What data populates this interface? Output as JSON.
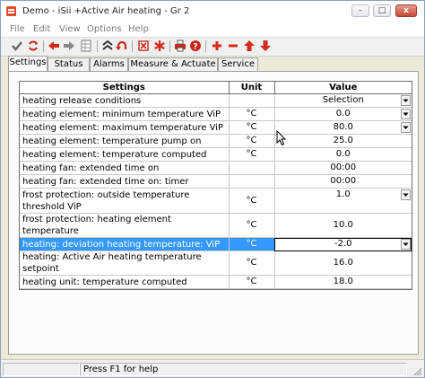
{
  "window": {
    "title": "Demo - iSii +Active Air heating - Gr 2",
    "controls": {
      "minimize": "–",
      "maximize": "□",
      "close": "x"
    }
  },
  "menu": [
    "File",
    "Edit",
    "View",
    "Options",
    "Help"
  ],
  "toolbar": {
    "icons": [
      "check-icon",
      "refresh-icon",
      "back-arrow-icon",
      "forward-arrow-icon",
      "grid-icon",
      "collapse-icon",
      "undo-icon",
      "cancel-box-icon",
      "asterisk-icon",
      "print-icon",
      "help-icon",
      "add-icon",
      "remove-icon",
      "move-up-icon",
      "move-down-icon"
    ]
  },
  "tabs": [
    {
      "label": "Settings",
      "active": true
    },
    {
      "label": "Status",
      "active": false
    },
    {
      "label": "Alarms",
      "active": false
    },
    {
      "label": "Measure & Actuate",
      "active": false
    },
    {
      "label": "Service",
      "active": false
    }
  ],
  "grid": {
    "headers": {
      "setting": "Settings",
      "unit": "Unit",
      "value": "Value"
    },
    "rows": [
      {
        "setting": "heating release conditions",
        "unit": "",
        "value": "Selection",
        "dropdown": true
      },
      {
        "setting": "heating element: minimum temperature ViP",
        "unit": "°C",
        "value": "0.0",
        "dropdown": true
      },
      {
        "setting": "heating element: maximum temperature ViP",
        "unit": "°C",
        "value": "80.0",
        "dropdown": true
      },
      {
        "setting": "heating element: temperature pump on",
        "unit": "°C",
        "value": "25.0",
        "dropdown": false
      },
      {
        "setting": "heating element: temperature computed",
        "unit": "°C",
        "value": "0.0",
        "dropdown": false
      },
      {
        "setting": "heating fan: extended time on",
        "unit": "",
        "value": "00:00",
        "dropdown": false
      },
      {
        "setting": "heating fan: extended time on: timer",
        "unit": "",
        "value": "00:00",
        "dropdown": false
      },
      {
        "setting": "frost protection: outside temperature threshold ViP",
        "unit": "°C",
        "value": "1.0",
        "dropdown": true,
        "tall": true
      },
      {
        "setting": "frost protection: heating element temperature",
        "unit": "°C",
        "value": "10.0",
        "dropdown": false
      },
      {
        "setting": "heating: deviation heating temperature: ViP",
        "unit": "°C",
        "value": "-2.0",
        "dropdown": true,
        "selected": true
      },
      {
        "setting": "heating: Active Air heating temperature setpoint",
        "unit": "°C",
        "value": "16.0",
        "dropdown": false
      },
      {
        "setting": "heating unit: temperature computed",
        "unit": "°C",
        "value": "18.0",
        "dropdown": false
      }
    ]
  },
  "status": {
    "help": "Press F1 for help"
  },
  "colors": {
    "selection": "#3399ff",
    "accent_red": "#d42a1c",
    "accent_green": "#2a8a2a"
  }
}
